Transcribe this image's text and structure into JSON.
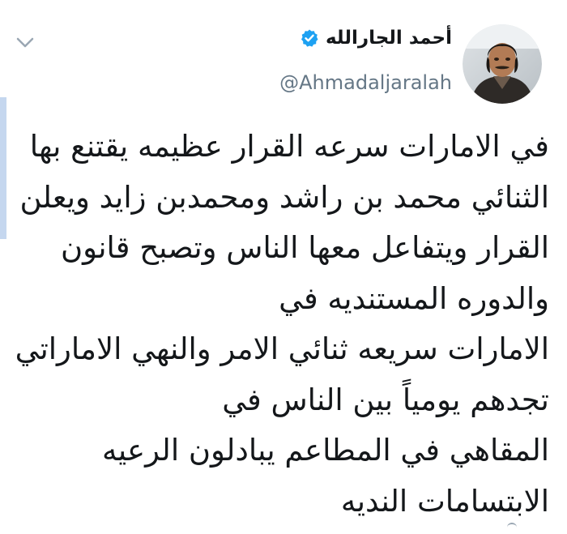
{
  "tweet": {
    "display_name": "أحمد الجارالله",
    "handle": "@Ahmadaljaralah",
    "text_lines": [
      "في الامارات سرعه القرار عظيمه يقتنع بها",
      "الثنائي محمد بن راشد ومحمدبن زايد ويعلن",
      "القرار ويتفاعل معها الناس وتصبح قانون",
      "والدوره المستنديه في",
      "الامارات سريعه ثنائي الامر والنهي الاماراتي",
      "تجدهم يومياً بين الناس في",
      "المقاهي في المطاعم يبادلون الرعيه",
      "الابتسامات النديه"
    ]
  },
  "icons": {
    "menu": "chevron-down-icon",
    "verified": "verified-badge-icon"
  },
  "colors": {
    "text": "#14171a",
    "muted": "#657786",
    "verified": "#1da1f2",
    "accent_bar": "#c5d7ef"
  }
}
